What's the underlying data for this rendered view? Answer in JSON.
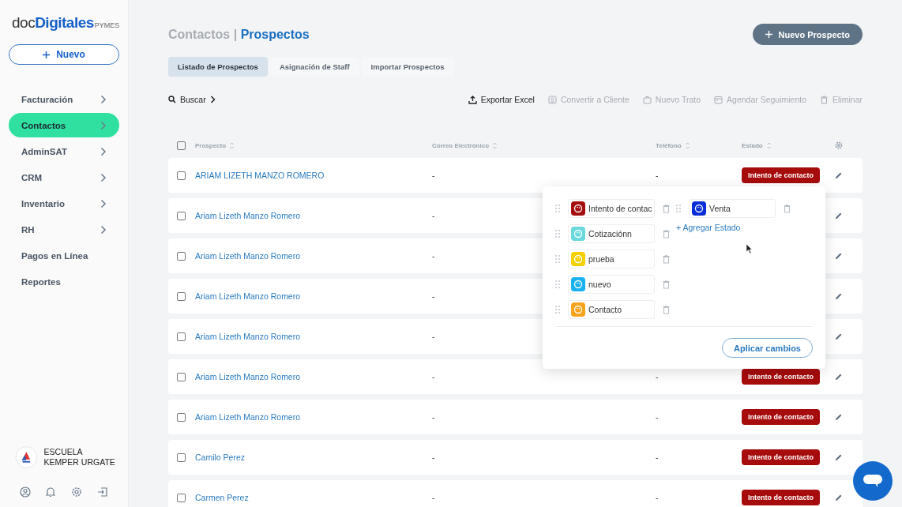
{
  "sidebar": {
    "logo": {
      "main_prefix": "doc",
      "main": "Digitales",
      "suffix": "PYMES"
    },
    "new_button": "Nuevo",
    "items": [
      {
        "label": "Facturación",
        "has_arrow": true,
        "selected": false
      },
      {
        "label": "Contactos",
        "has_arrow": true,
        "selected": true
      },
      {
        "label": "AdminSAT",
        "has_arrow": true,
        "selected": false
      },
      {
        "label": "CRM",
        "has_arrow": true,
        "selected": false
      },
      {
        "label": "Inventario",
        "has_arrow": true,
        "selected": false
      },
      {
        "label": "RH",
        "has_arrow": true,
        "selected": false
      },
      {
        "label": "Pagos en Línea",
        "has_arrow": false,
        "selected": false
      },
      {
        "label": "Reportes",
        "has_arrow": false,
        "selected": false
      }
    ],
    "account": "ESCUELA KEMPER URGATE"
  },
  "header": {
    "breadcrumb": "Contactos",
    "separator": "|",
    "title": "Prospectos",
    "action": "Nuevo Prospecto"
  },
  "tabs": [
    {
      "label": "Listado de Prospectos",
      "selected": true
    },
    {
      "label": "Asignación de Staff",
      "selected": false
    },
    {
      "label": "Importar Prospectos",
      "selected": false
    }
  ],
  "toolbar": {
    "search": "Buscar",
    "actions": [
      {
        "label": "Exportar Excel",
        "kind": "export",
        "disabled": false
      },
      {
        "label": "Convertir a Cliente",
        "kind": "convert",
        "disabled": true
      },
      {
        "label": "Nuevo Trato",
        "kind": "deal",
        "disabled": true
      },
      {
        "label": "Agendar Seguimiento",
        "kind": "calendar",
        "disabled": true
      },
      {
        "label": "Eliminar",
        "kind": "delete",
        "disabled": true
      }
    ]
  },
  "table": {
    "all_checked": false,
    "columns": [
      "Prospecto",
      "Correo Electrónico",
      "Teléfono",
      "Estado"
    ],
    "rows": [
      {
        "name": "ARIAM LIZETH MANZO ROMERO",
        "email": "-",
        "phone": "-",
        "status": "Intento de contacto",
        "checked": false
      },
      {
        "name": "Ariam Lizeth Manzo Romero",
        "email": "-",
        "checked": false
      },
      {
        "name": "Ariam Lizeth Manzo Romero",
        "email": "-",
        "checked": false
      },
      {
        "name": "Ariam Lizeth Manzo Romero",
        "email": "-",
        "checked": false
      },
      {
        "name": "Ariam Lizeth Manzo Romero",
        "email": "-",
        "checked": false
      },
      {
        "name": "Ariam Lizeth Manzo Romero",
        "email": "-",
        "phone": "-",
        "status": "Intento de contacto",
        "checked": false
      },
      {
        "name": "Ariam Lizeth Manzo Romero",
        "email": "-",
        "phone": "-",
        "status": "Intento de contacto",
        "checked": false
      },
      {
        "name": "Camilo Perez",
        "email": "-",
        "phone": "-",
        "status": "Intento de contacto",
        "checked": false
      },
      {
        "name": "Carmen Perez",
        "email": "-",
        "phone": "-",
        "status": "Intento de contacto",
        "checked": false
      }
    ]
  },
  "status_popover": {
    "columns": [
      [
        {
          "label": "Intento de contac",
          "color": "#a50e0e"
        },
        {
          "label": "Cotizaciónn",
          "color": "#6ad9de"
        },
        {
          "label": "prueba",
          "color": "#f5d000"
        },
        {
          "label": "nuevo",
          "color": "#1ab1f0"
        },
        {
          "label": "Contacto",
          "color": "#f7a21b"
        }
      ],
      [
        {
          "label": "Venta",
          "color": "#0a2ed6"
        }
      ]
    ],
    "add": "+ Agregar Estado",
    "apply": "Aplicar cambios"
  }
}
